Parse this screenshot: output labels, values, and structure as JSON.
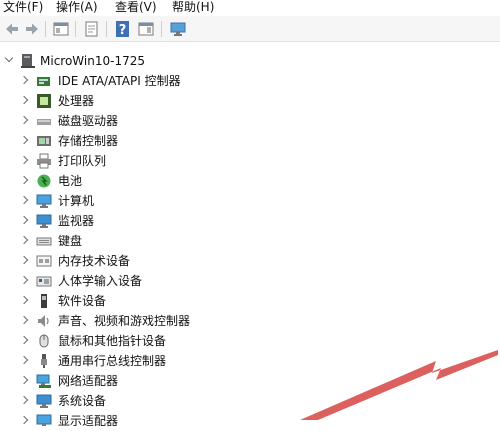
{
  "menu": [
    "文件(F)",
    "操作(A)",
    "查看(V)",
    "帮助(H)"
  ],
  "toolbar_icons": [
    "back-arrow-icon",
    "forward-arrow-icon",
    "console-tree-icon",
    "properties-icon",
    "help-icon",
    "action-pane-icon",
    "monitor-icon"
  ],
  "tree": {
    "root": "MicroWin10-1725",
    "categories": [
      {
        "label": "IDE ATA/ATAPI 控制器",
        "icon": "ide-controller-icon"
      },
      {
        "label": "处理器",
        "icon": "processor-icon"
      },
      {
        "label": "磁盘驱动器",
        "icon": "disk-drive-icon"
      },
      {
        "label": "存储控制器",
        "icon": "storage-controller-icon"
      },
      {
        "label": "打印队列",
        "icon": "printer-icon"
      },
      {
        "label": "电池",
        "icon": "battery-icon"
      },
      {
        "label": "计算机",
        "icon": "computer-icon"
      },
      {
        "label": "监视器",
        "icon": "monitor-icon"
      },
      {
        "label": "键盘",
        "icon": "keyboard-icon"
      },
      {
        "label": "内存技术设备",
        "icon": "memory-icon"
      },
      {
        "label": "人体学输入设备",
        "icon": "hid-icon"
      },
      {
        "label": "软件设备",
        "icon": "software-device-icon"
      },
      {
        "label": "声音、视频和游戏控制器",
        "icon": "sound-icon"
      },
      {
        "label": "鼠标和其他指针设备",
        "icon": "mouse-icon"
      },
      {
        "label": "通用串行总线控制器",
        "icon": "usb-icon"
      },
      {
        "label": "网络适配器",
        "icon": "network-adapter-icon"
      },
      {
        "label": "系统设备",
        "icon": "system-device-icon"
      },
      {
        "label": "显示适配器",
        "icon": "display-adapter-icon"
      }
    ]
  },
  "annotation": {
    "color": "#d9534f",
    "icon": "red-arrow-annotation"
  }
}
